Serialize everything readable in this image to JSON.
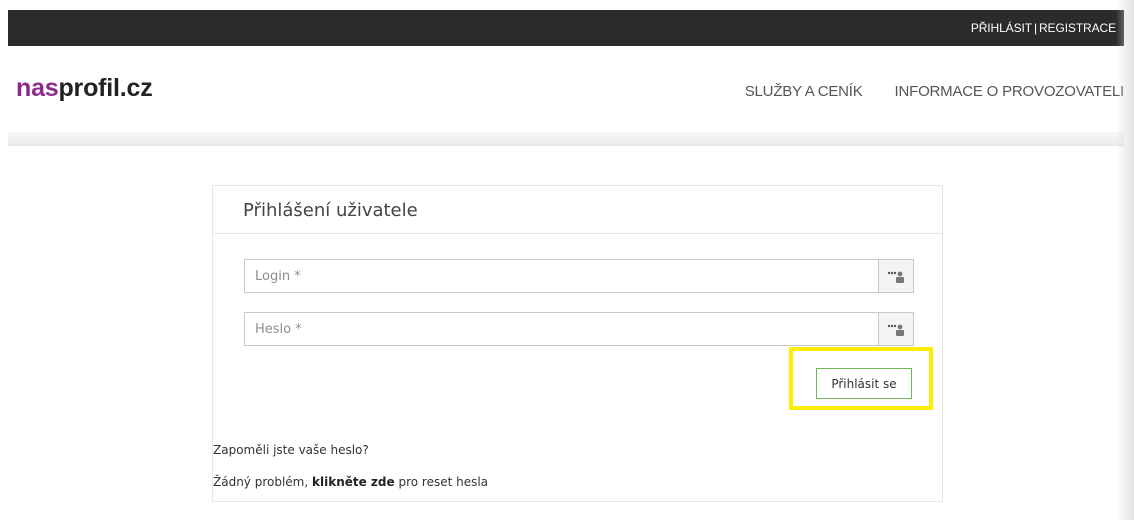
{
  "topbar": {
    "login_label": "PŘIHLÁSIT",
    "separator": "|",
    "register_label": "REGISTRACE"
  },
  "header": {
    "logo": {
      "part1": "nas",
      "part2": "profil.cz",
      "part1_color": "#8b2a8b",
      "part2_color": "#222222"
    },
    "nav": [
      {
        "label": "SLUŽBY A CENÍK"
      },
      {
        "label": "INFORMACE O PROVOZOVATELI"
      }
    ]
  },
  "login_form": {
    "title": "Přihlášení uživatele",
    "login_placeholder": "Login *",
    "login_value": "",
    "password_placeholder": "Heslo *",
    "password_value": "",
    "field_icon": "password-manager-icon",
    "submit_label": "Přihlásit se",
    "highlight_color": "#ffee00",
    "submit_border_color": "#75b85a"
  },
  "forgot": {
    "title": "Zapoměli jste vaše heslo?",
    "prefix": "Žádný problém, ",
    "link": "klikněte zde",
    "suffix": " pro reset hesla"
  }
}
